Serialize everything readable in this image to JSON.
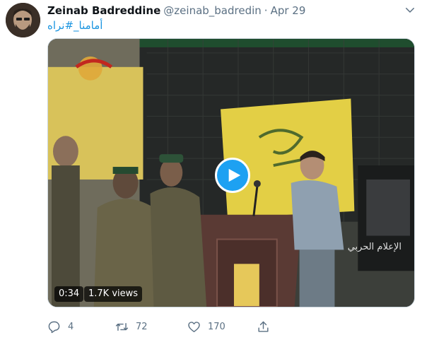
{
  "tweet": {
    "author_name": "Zeinab Badreddine",
    "handle": "@zeinab_badredin",
    "separator": "·",
    "time": "Apr 29",
    "hashtag_text": "أمامنا_#نراه"
  },
  "media": {
    "duration": "0:34",
    "views": "1.7K views",
    "watermark": "الإعلام الحربي"
  },
  "actions": {
    "reply_count": "4",
    "retweet_count": "72",
    "like_count": "170"
  },
  "colors": {
    "link": "#1b95e0",
    "accent": "#1da1f2",
    "muted": "#5b7083"
  },
  "icons": [
    "chevron-down-icon",
    "play-icon",
    "reply-icon",
    "retweet-icon",
    "like-icon",
    "share-icon"
  ]
}
